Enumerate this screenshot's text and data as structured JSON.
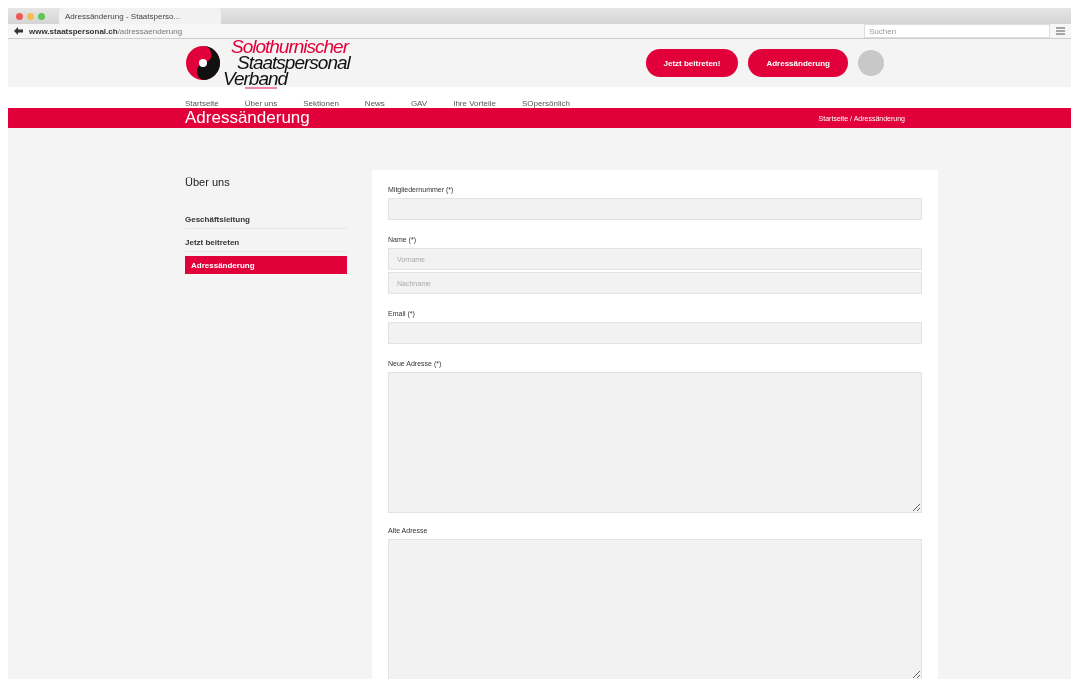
{
  "browser": {
    "tab_title": "Adressänderung - Staatsperso...",
    "url_domain": "www.staatspersonal.ch",
    "url_path": "/adressaenderung",
    "search_placeholder": "Suchen"
  },
  "header": {
    "logo_lines": [
      "Solothurnischer",
      "Staatspersonal",
      "Verband"
    ],
    "buttons": [
      "Jetzt beitreten!",
      "Adressänderung"
    ]
  },
  "nav": [
    {
      "label": "Startseite",
      "selected": false
    },
    {
      "label": "Über uns",
      "selected": true
    },
    {
      "label": "Sektionen",
      "selected": false
    },
    {
      "label": "News",
      "selected": false
    },
    {
      "label": "GAV",
      "selected": false
    },
    {
      "label": "Ihre Vorteile",
      "selected": false
    },
    {
      "label": "SOpersönlich",
      "selected": false
    }
  ],
  "banner": {
    "title": "Adressänderung",
    "breadcrumb": "Startseite / Adressänderung"
  },
  "sidebar": {
    "title": "Über uns",
    "items": [
      {
        "label": "Geschäftsleitung",
        "selected": false
      },
      {
        "label": "Jetzt beitreten",
        "selected": false
      },
      {
        "label": "Adressänderung",
        "selected": true
      }
    ]
  },
  "form": [
    {
      "kind": "input",
      "label": "Mitgliedernummer (*)"
    },
    {
      "kind": "name",
      "label": "Name (*)",
      "placeholders": [
        "Vorname",
        "Nachname"
      ]
    },
    {
      "kind": "input",
      "label": "Email (*)"
    },
    {
      "kind": "textarea",
      "label": "Neue Adresse (*)"
    },
    {
      "kind": "textarea",
      "label": "Alte Adresse"
    }
  ]
}
